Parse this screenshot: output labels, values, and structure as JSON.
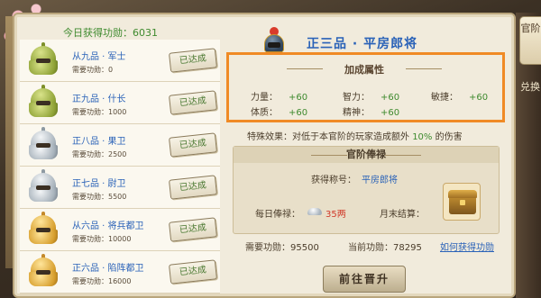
{
  "today_merit": {
    "label": "今日获得功勋：",
    "value": "6031"
  },
  "ranks": [
    {
      "name": "从九品 · 军士",
      "need": "需要功勋：0",
      "status": "已达成",
      "color": "green"
    },
    {
      "name": "正九品 · 什长",
      "need": "需要功勋：1000",
      "status": "已达成",
      "color": "green"
    },
    {
      "name": "正八品 · 果卫",
      "need": "需要功勋：2500",
      "status": "已达成",
      "color": "silver"
    },
    {
      "name": "正七品 · 尉卫",
      "need": "需要功勋：5500",
      "status": "已达成",
      "color": "silver"
    },
    {
      "name": "从六品 · 将兵都卫",
      "need": "需要功勋：10000",
      "status": "已达成",
      "color": "gold"
    },
    {
      "name": "正六品 · 陷阵都卫",
      "need": "需要功勋：16000",
      "status": "已达成",
      "color": "gold"
    }
  ],
  "detail": {
    "title": "正三品 · 平房郎将",
    "attr_header": "加成属性",
    "attrs": [
      {
        "label": "力量：",
        "value": "+60"
      },
      {
        "label": "智力：",
        "value": "+60"
      },
      {
        "label": "敏捷：",
        "value": "+60"
      },
      {
        "label": "体质：",
        "value": "+60"
      },
      {
        "label": "精神：",
        "value": "+60"
      }
    ],
    "special": {
      "prefix": "特殊效果：对低于本官阶的玩家造成额外 ",
      "percent": "10%",
      "suffix": " 的伤害"
    }
  },
  "salary": {
    "header": "官阶俸禄",
    "title_label": "获得称号：",
    "title_value": "平房郎将",
    "daily_label": "每日俸禄：",
    "daily_amount": "35两",
    "monthly_label": "月末结算："
  },
  "merit": {
    "need": "需要功勋：95500",
    "have": "当前功勋：78295",
    "how": "如何获得功勋"
  },
  "promote_button": "前往晋升",
  "tabs": {
    "active": "官阶",
    "other": "兑换"
  }
}
